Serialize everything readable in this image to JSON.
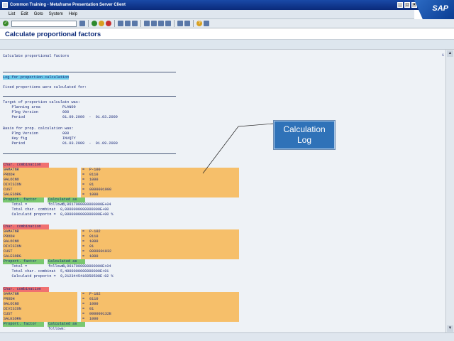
{
  "window": {
    "title": "Common Training - Metaframe Presentation Server Client"
  },
  "brand": "SAP",
  "menu": {
    "items": [
      "List",
      "Edit",
      "Goto",
      "System",
      "Help"
    ]
  },
  "screen": {
    "title": "Calculate proportional factors",
    "list_title": "Calculate proportional factors",
    "page": "1"
  },
  "log": {
    "heading": "Log for proportion calculation",
    "fixed": "Fixed proportions were calculated for:",
    "target_hdr": "Target of proportion calculatn was:",
    "target": [
      {
        "label": "    Planning area",
        "value": "PLAN09"
      },
      {
        "label": "    Plng Version",
        "value": "000"
      },
      {
        "label": "    Period",
        "value": "01.09.2009  -  01.03.2009"
      }
    ],
    "basis_hdr": "Basis for prop. calculation was:",
    "basis": [
      {
        "label": "    Plng Version",
        "value": "000"
      },
      {
        "label": "    Key fig",
        "value": "INVQTY"
      },
      {
        "label": "    Period",
        "value": "01.03.2009  -  01.09.2009"
      }
    ]
  },
  "combos": [
    {
      "header": "Char. combination",
      "rows": [
        {
          "char": "9AMATNR",
          "eq": "=",
          "val": "P-100"
        },
        {
          "char": "PRODH",
          "eq": "=",
          "val": "0110"
        },
        {
          "char": "9ALOCNO",
          "eq": "=",
          "val": "1000"
        },
        {
          "char": "DIVISION",
          "eq": "=",
          "val": "01"
        },
        {
          "char": "CUST",
          "eq": "=",
          "val": "0000001000"
        },
        {
          "char": "SALESORG",
          "eq": "=",
          "val": "1000"
        }
      ],
      "factor_label": "Proport. factor",
      "calc_label": "Calculated as follows:",
      "calc": [
        "    Total =                5,0617000000000000E+04",
        "    Total char. combinat  0,0000000000000000E+00",
        "    Calculatd proportn =  0,0000000000000000E+00 %"
      ]
    },
    {
      "header": "Char. combination",
      "rows": [
        {
          "char": "9AMATNR",
          "eq": "=",
          "val": "P-102"
        },
        {
          "char": "PRODH",
          "eq": "=",
          "val": "0110"
        },
        {
          "char": "9ALOCNO",
          "eq": "=",
          "val": "1000"
        },
        {
          "char": "DIVISION",
          "eq": "=",
          "val": "01"
        },
        {
          "char": "CUST",
          "eq": "=",
          "val": "0000001032"
        },
        {
          "char": "SALESORG",
          "eq": "=",
          "val": "1000"
        }
      ],
      "factor_label": "Proport. factor",
      "calc_label": "Calculated as follows:",
      "calc": [
        "    Total =                5,0617000000000000E+04",
        "    Total char. combinat  5,4000000000000000E+01",
        "    Calculatd proportn =  9,2123445416050508E-02 %"
      ]
    },
    {
      "header": "Char. combination",
      "rows": [
        {
          "char": "9AMATNR",
          "eq": "=",
          "val": "P-102"
        },
        {
          "char": "PRODH",
          "eq": "=",
          "val": "0110"
        },
        {
          "char": "9ALOCNO",
          "eq": "=",
          "val": "1000"
        },
        {
          "char": "DIVISION",
          "eq": "=",
          "val": "01"
        },
        {
          "char": "CUST",
          "eq": "=",
          "val": "000000132E"
        },
        {
          "char": "SALESORG",
          "eq": "=",
          "val": "1000"
        }
      ],
      "factor_label": "Proport. factor",
      "calc_label": "Calculated as follows:",
      "calc": []
    }
  ],
  "callout": {
    "line1": "Calculation",
    "line2": "Log"
  },
  "colors": {
    "title_bar": "#1a4aa8",
    "callout": "#2f72b8",
    "heading_cyan": "#68c8e8",
    "combo_red": "#f07070",
    "factor_green": "#7ac870",
    "row_orange": "#f6bf6a"
  }
}
